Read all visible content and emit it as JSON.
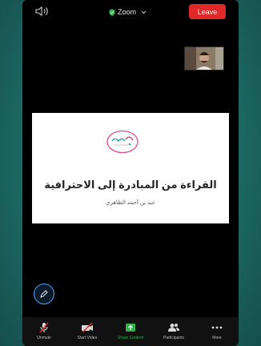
{
  "topbar": {
    "title": "Zoom",
    "leave_label": "Leave",
    "icons": [
      "speaker-icon",
      "shield-check-icon",
      "chevron-down-icon"
    ]
  },
  "slide": {
    "title": "القراءة من المبادرة إلى الاحترافية",
    "author": "عبد بن أحمد الظاهري"
  },
  "toolbar": {
    "items": [
      {
        "label": "Unmute",
        "icon": "mic-muted-icon"
      },
      {
        "label": "Start Video",
        "icon": "video-off-icon"
      },
      {
        "label": "Share Content",
        "icon": "share-icon"
      },
      {
        "label": "Participants",
        "icon": "participants-icon"
      },
      {
        "label": "More",
        "icon": "more-icon"
      }
    ]
  },
  "colors": {
    "leave": "#e02828",
    "share": "#2fb24c",
    "accent_fab": "#4a9cf0",
    "logo_pink": "#e24f8c",
    "logo_teal": "#2fa8a8"
  }
}
